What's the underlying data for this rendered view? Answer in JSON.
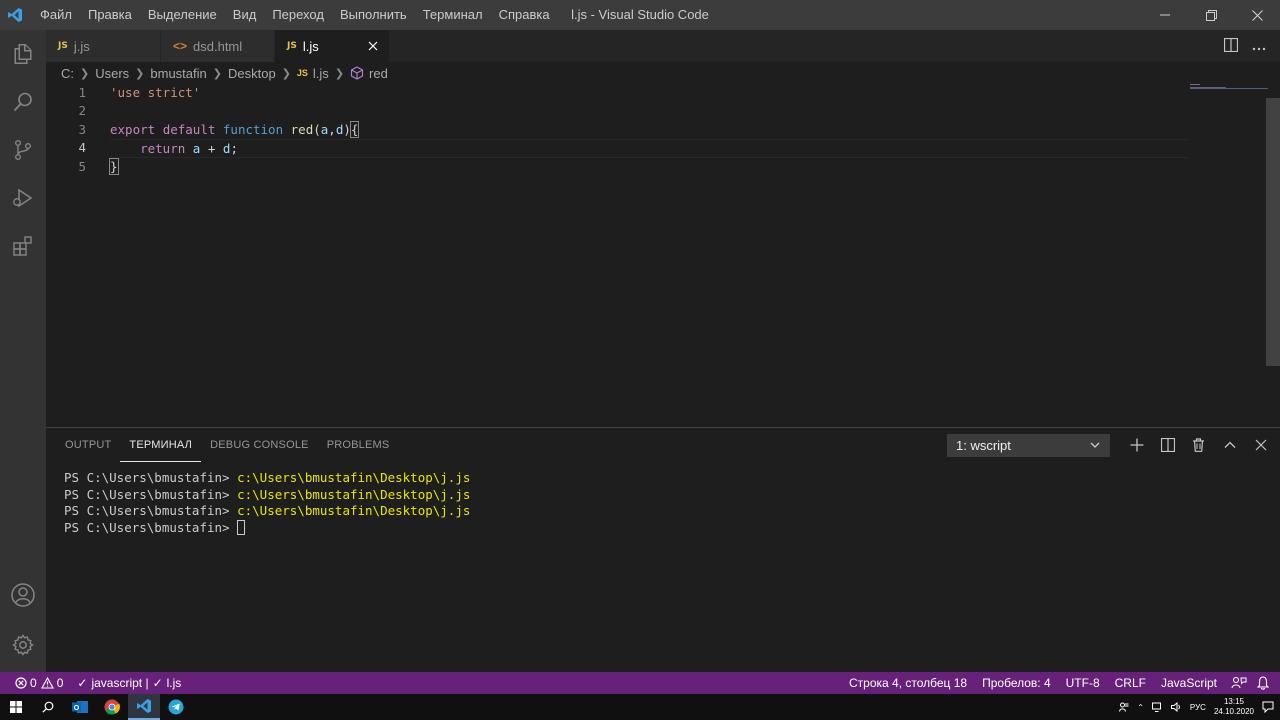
{
  "window": {
    "title": "l.js - Visual Studio Code",
    "menu": [
      "Файл",
      "Правка",
      "Выделение",
      "Вид",
      "Переход",
      "Выполнить",
      "Терминал",
      "Справка"
    ]
  },
  "activity_bar": {
    "items": [
      "explorer-icon",
      "search-icon",
      "source-control-icon",
      "run-debug-icon",
      "extensions-icon"
    ],
    "bottom": [
      "account-icon",
      "settings-gear-icon"
    ]
  },
  "tabs": [
    {
      "label": "j.js",
      "icon": "JS",
      "active": false
    },
    {
      "label": "dsd.html",
      "icon": "<>",
      "active": false
    },
    {
      "label": "l.js",
      "icon": "JS",
      "active": true
    }
  ],
  "breadcrumb": {
    "segments": [
      "C:",
      "Users",
      "bmustafin",
      "Desktop"
    ],
    "file_icon": "JS",
    "file": "l.js",
    "symbol": "red"
  },
  "editor": {
    "line_numbers": [
      "1",
      "2",
      "3",
      "4",
      "5"
    ],
    "active_line": 4,
    "lines": {
      "l1_str": "'use strict'",
      "l3_export": "export",
      "l3_default": "default",
      "l3_function": "function",
      "l3_name": "red",
      "l3_open": "(",
      "l3_a": "a",
      "l3_comma": ",",
      "l3_d": "d",
      "l3_close": ")",
      "l3_brace": "{",
      "l4_indent": "    ",
      "l4_return": "return",
      "l4_a": "a",
      "l4_plus": " + ",
      "l4_d": "d",
      "l4_semi": ";",
      "l5_brace": "}"
    }
  },
  "panel": {
    "tabs": [
      "OUTPUT",
      "ТЕРМИНАЛ",
      "DEBUG CONSOLE",
      "PROBLEMS"
    ],
    "active_tab": "ТЕРМИНАЛ",
    "terminal_select": "1: wscript",
    "terminal_lines": [
      {
        "prompt": "PS C:\\Users\\bmustafin> ",
        "command": "c:\\Users\\bmustafin\\Desktop\\j.js"
      },
      {
        "prompt": "PS C:\\Users\\bmustafin> ",
        "command": "c:\\Users\\bmustafin\\Desktop\\j.js"
      },
      {
        "prompt": "PS C:\\Users\\bmustafin> ",
        "command": "c:\\Users\\bmustafin\\Desktop\\j.js"
      },
      {
        "prompt": "PS C:\\Users\\bmustafin> ",
        "command": ""
      }
    ]
  },
  "statusbar": {
    "errors": "0",
    "warnings": "0",
    "lint": "javascript |",
    "lint_file": "l.js",
    "position": "Строка 4, столбец 18",
    "spaces": "Пробелов: 4",
    "encoding": "UTF-8",
    "eol": "CRLF",
    "language": "JavaScript",
    "color": "#68217a"
  },
  "taskbar": {
    "apps": [
      "windows-start-icon",
      "search-icon",
      "outlook-icon",
      "chrome-icon",
      "vscode-icon",
      "telegram-icon"
    ],
    "lang": "РУС",
    "time": "13:15",
    "date": "24.10.2020"
  }
}
